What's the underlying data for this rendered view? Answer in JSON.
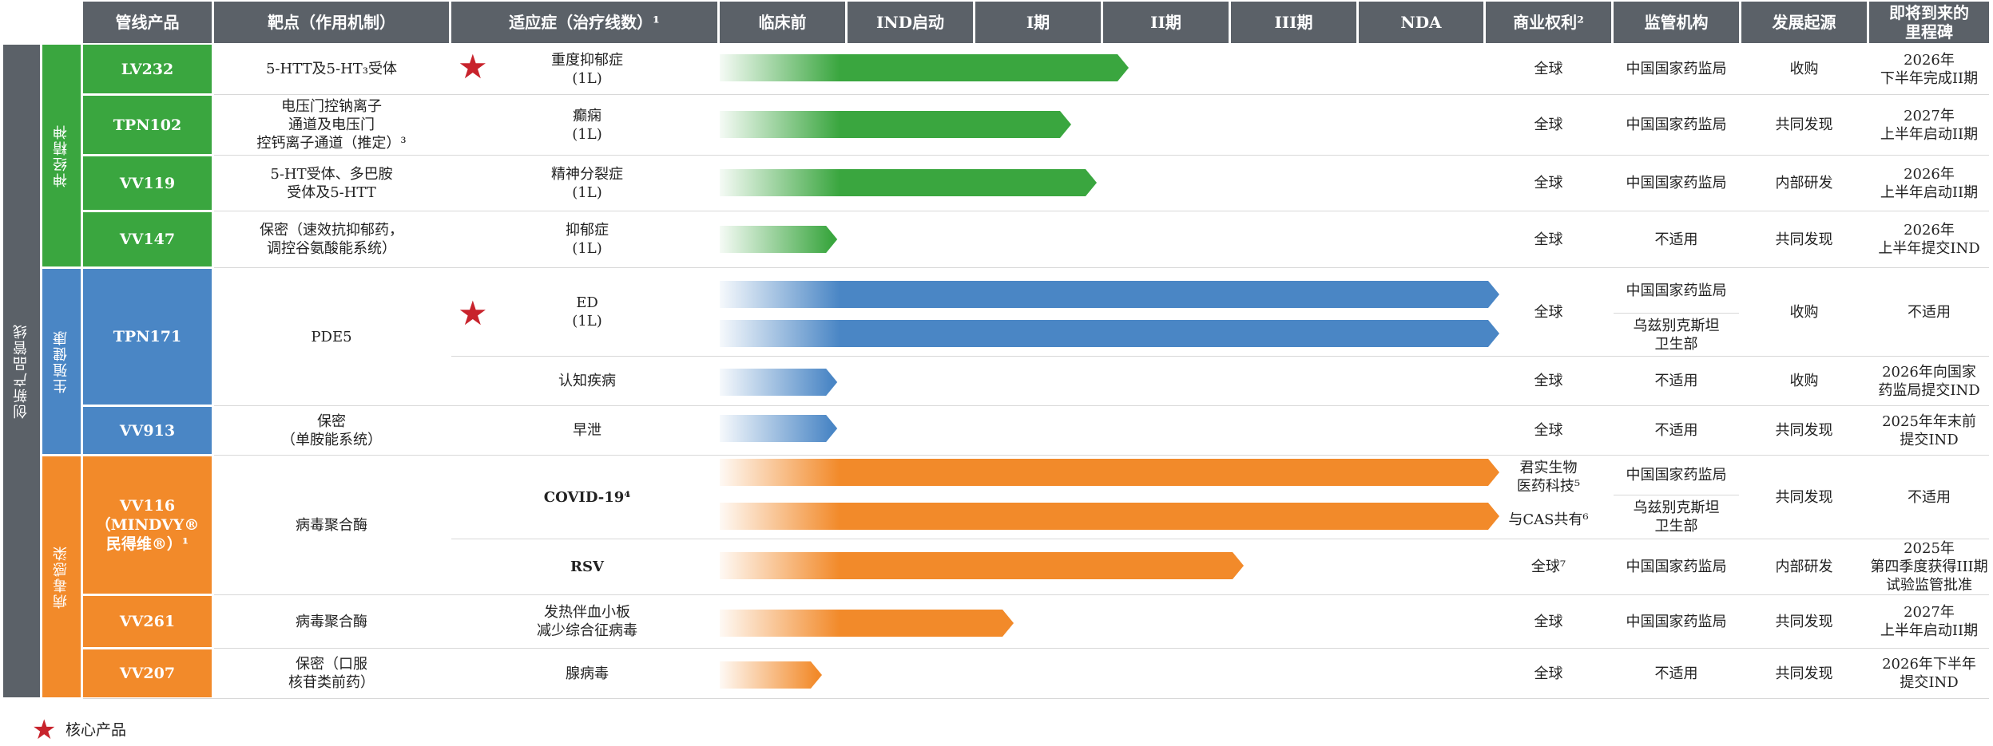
{
  "headers": {
    "product": "管线产品",
    "target": "靶点（作用机制）",
    "indication": "适应症（治疗线数）¹",
    "phases": [
      "临床前",
      "IND启动",
      "I期",
      "II期",
      "III期",
      "NDA"
    ],
    "rights": "商业权利²",
    "regulator": "监管机构",
    "origin": "发展起源",
    "milestone": "即将到来的\n里程碑"
  },
  "sidebar_label": "创新产品管线",
  "categories": [
    {
      "label": "神经精神",
      "color": "#3aa63f"
    },
    {
      "label": "生殖健康",
      "color": "#4a86c5"
    },
    {
      "label": "病毒感染",
      "color": "#f28a2a"
    }
  ],
  "products": [
    {
      "code": "LV232",
      "target": "5-HTT及5-HT₃受体",
      "indication": "重度抑郁症\n(1L)",
      "rights": "全球",
      "regulator": "中国国家药监局",
      "origin": "收购",
      "milestone": "2026年\n下半年完成II期"
    },
    {
      "code": "TPN102",
      "target": "电压门控钠离子\n通道及电压门\n控钙离子通道（推定）³",
      "indication": "癫痫\n(1L)",
      "rights": "全球",
      "regulator": "中国国家药监局",
      "origin": "共同发现",
      "milestone": "2027年\n上半年启动II期"
    },
    {
      "code": "VV119",
      "target": "5-HT受体、多巴胺\n受体及5-HTT",
      "indication": "精神分裂症\n(1L)",
      "rights": "全球",
      "regulator": "中国国家药监局",
      "origin": "内部研发",
      "milestone": "2026年\n上半年启动II期"
    },
    {
      "code": "VV147",
      "target": "保密（速效抗抑郁药，\n调控谷氨酸能系统）",
      "indication": "抑郁症\n(1L)",
      "rights": "全球",
      "regulator": "不适用",
      "origin": "共同发现",
      "milestone": "2026年\n上半年提交IND"
    },
    {
      "code": "TPN171",
      "target": "PDE5",
      "indication": "ED\n(1L)",
      "rights": "全球",
      "regulator": "中国国家药监局",
      "regulator2": "乌兹别克斯坦\n卫生部",
      "origin": "收购",
      "milestone": "不适用",
      "indication2": "认知疾病",
      "rights2": "全球",
      "regulator3": "不适用",
      "origin2": "收购",
      "milestone2": "2026年向国家\n药监局提交IND"
    },
    {
      "code": "VV913",
      "target": "保密\n（单胺能系统）",
      "indication": "早泄",
      "rights": "全球",
      "regulator": "不适用",
      "origin": "共同发现",
      "milestone": "2025年年末前\n提交IND"
    },
    {
      "code": "VV116\n（MINDVY®\n民得维®）¹",
      "target": "病毒聚合酶",
      "indication": "COVID-19⁴",
      "rights": "君实生物\n医药科技⁵",
      "rights_b": "与CAS共有⁶",
      "regulator": "中国国家药监局",
      "regulator2": "乌兹别克斯坦\n卫生部",
      "origin": "共同发现",
      "milestone": "不适用",
      "indication2": "RSV",
      "rights2": "全球⁷",
      "regulator3": "中国国家药监局",
      "origin2": "内部研发",
      "milestone2": "2025年\n第四季度获得III期\n试验监管批准"
    },
    {
      "code": "VV261",
      "target": "病毒聚合酶",
      "indication": "发热伴血小板\n减少综合征病毒",
      "rights": "全球",
      "regulator": "中国国家药监局",
      "origin": "共同发现",
      "milestone": "2027年\n上半年启动II期"
    },
    {
      "code": "VV207",
      "target": "保密（口服\n核苷类前药）",
      "indication": "腺病毒",
      "rights": "全球",
      "regulator": "不适用",
      "origin": "共同发现",
      "milestone": "2026年下半年\n提交IND"
    }
  ],
  "legend": {
    "label": "核心产品"
  },
  "chart_data": {
    "type": "bar",
    "orientation": "horizontal",
    "stages": [
      "临床前",
      "IND启动",
      "I期",
      "II期",
      "III期",
      "NDA"
    ],
    "progress_unit": "stage columns completed (0 = start of 临床前, 6 = end of NDA)",
    "bars": [
      {
        "product": "LV232",
        "indication": "重度抑郁症",
        "progress": 3.2,
        "color": "#3aa63f"
      },
      {
        "product": "TPN102",
        "indication": "癫痫",
        "progress": 2.75,
        "color": "#3aa63f"
      },
      {
        "product": "VV119",
        "indication": "精神分裂症",
        "progress": 2.95,
        "color": "#3aa63f"
      },
      {
        "product": "VV147",
        "indication": "抑郁症",
        "progress": 0.92,
        "color": "#3aa63f"
      },
      {
        "product": "TPN171",
        "indication": "ED",
        "progress": 6.1,
        "color": "#4a86c5"
      },
      {
        "product": "TPN171",
        "indication": "ED",
        "progress": 6.1,
        "color": "#4a86c5"
      },
      {
        "product": "TPN171",
        "indication": "认知疾病",
        "progress": 0.92,
        "color": "#4a86c5"
      },
      {
        "product": "VV913",
        "indication": "早泄",
        "progress": 0.92,
        "color": "#4a86c5"
      },
      {
        "product": "VV116",
        "indication": "COVID-19",
        "progress": 6.1,
        "color": "#f28a2a"
      },
      {
        "product": "VV116",
        "indication": "COVID-19",
        "progress": 6.1,
        "color": "#f28a2a"
      },
      {
        "product": "VV116",
        "indication": "RSV",
        "progress": 4.1,
        "color": "#f28a2a"
      },
      {
        "product": "VV261",
        "indication": "发热伴血小板减少综合征病毒",
        "progress": 2.3,
        "color": "#f28a2a"
      },
      {
        "product": "VV207",
        "indication": "腺病毒",
        "progress": 0.8,
        "color": "#f28a2a"
      }
    ],
    "core_products": [
      "LV232",
      "TPN171"
    ]
  }
}
